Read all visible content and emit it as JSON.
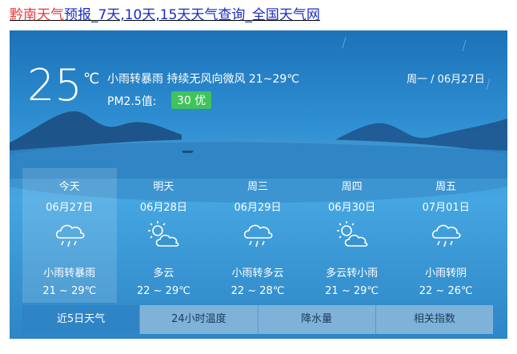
{
  "header": {
    "city": "黔南天气",
    "link_text": "预报_7天,10天,15天天气查询_全国天气网"
  },
  "current": {
    "temp": "25",
    "unit": "℃",
    "desc": "小雨转暴雨   持续无风向微风   21~29℃",
    "pm_label": "PM2.5值:",
    "pm_value": "30 优",
    "date": "周一 / 06月27日"
  },
  "forecast": [
    {
      "name": "今天",
      "date": "06月27日",
      "icon": "cloud-rain-icon",
      "cond": "小雨转暴雨",
      "range": "21 ~ 29℃"
    },
    {
      "name": "明天",
      "date": "06月28日",
      "icon": "sun-cloud-icon",
      "cond": "多云",
      "range": "22 ~ 29℃"
    },
    {
      "name": "周三",
      "date": "06月29日",
      "icon": "cloud-rain-icon",
      "cond": "小雨转多云",
      "range": "22 ~ 28℃"
    },
    {
      "name": "周四",
      "date": "06月30日",
      "icon": "sun-cloud-icon",
      "cond": "多云转小雨",
      "range": "21 ~ 29℃"
    },
    {
      "name": "周五",
      "date": "07月01日",
      "icon": "cloud-rain-icon",
      "cond": "小雨转阴",
      "range": "22 ~ 26℃"
    }
  ],
  "tabs": [
    "近5日天气",
    "24小时温度",
    "降水量",
    "相关指数"
  ],
  "colors": {
    "pm_good": "#3fc35b",
    "link": "#1a2cc2",
    "city": "#e8383d"
  }
}
